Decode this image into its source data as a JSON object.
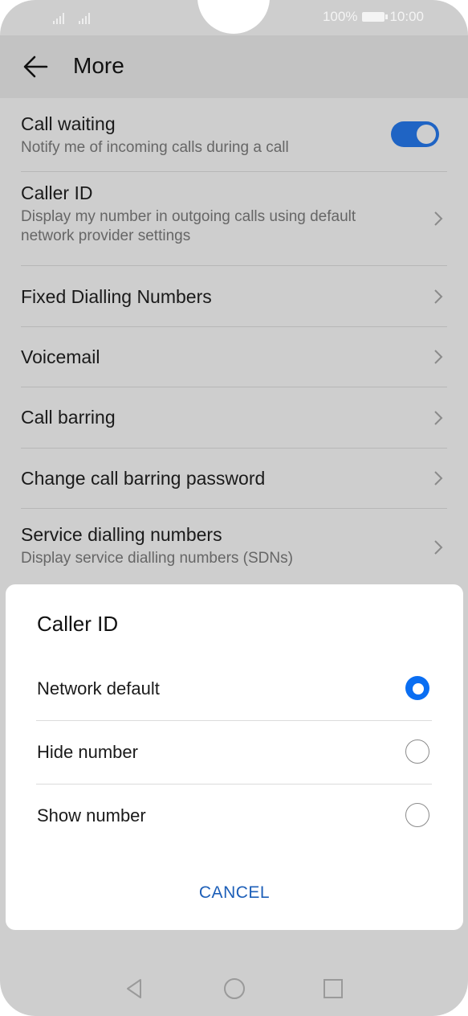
{
  "status_bar": {
    "battery_percent": "100%",
    "time": "10:00",
    "icons": [
      "signal-icon",
      "signal-icon",
      "battery-icon"
    ]
  },
  "header": {
    "title": "More",
    "back_icon": "arrow-left-icon"
  },
  "settings": {
    "call_waiting": {
      "title": "Call waiting",
      "subtitle": "Notify me of incoming calls during a call",
      "enabled": true
    },
    "caller_id": {
      "title": "Caller ID",
      "subtitle": "Display my number in outgoing calls using default network provider settings"
    },
    "fixed_dialling": {
      "title": "Fixed Dialling Numbers"
    },
    "voicemail": {
      "title": "Voicemail"
    },
    "call_barring": {
      "title": "Call barring"
    },
    "change_password": {
      "title": "Change call barring password"
    },
    "service_dialling": {
      "title": "Service dialling numbers",
      "subtitle": "Display service dialling numbers (SDNs)"
    }
  },
  "dialog": {
    "title": "Caller ID",
    "options": [
      {
        "label": "Network default",
        "selected": true
      },
      {
        "label": "Hide number",
        "selected": false
      },
      {
        "label": "Show number",
        "selected": false
      }
    ],
    "cancel_label": "CANCEL"
  },
  "colors": {
    "accent": "#0a6ef2",
    "cancel_text": "#1d5fb8",
    "toggle_on": "#1f64c4"
  },
  "nav_bar": {
    "icons": [
      "back-triangle-icon",
      "home-circle-icon",
      "recents-square-icon"
    ]
  }
}
